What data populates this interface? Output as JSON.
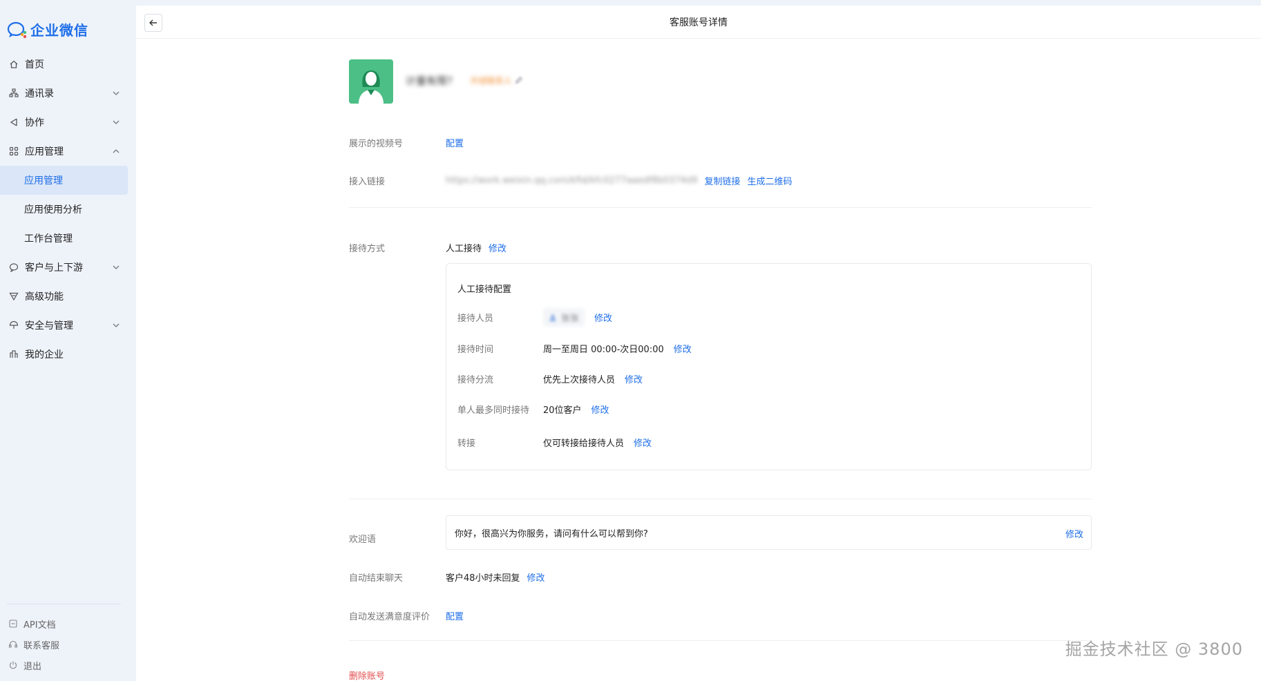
{
  "app": {
    "name": "企业微信",
    "brand_color": "#1e6ee8"
  },
  "sidebar": {
    "items": [
      {
        "label": "首页",
        "icon": "home-icon"
      },
      {
        "label": "通讯录",
        "icon": "org-chart-icon",
        "expandable": true
      },
      {
        "label": "协作",
        "icon": "share-icon",
        "expandable": true
      },
      {
        "label": "应用管理",
        "icon": "grid-icon",
        "expanded": true
      },
      {
        "label": "应用管理",
        "sub": true,
        "active": true
      },
      {
        "label": "应用使用分析",
        "sub": true
      },
      {
        "label": "工作台管理",
        "sub": true
      },
      {
        "label": "客户与上下游",
        "icon": "chat-icon",
        "expandable": true
      },
      {
        "label": "高级功能",
        "icon": "triangle-icon"
      },
      {
        "label": "安全与管理",
        "icon": "umbrella-icon",
        "expandable": true
      },
      {
        "label": "我的企业",
        "icon": "building-icon"
      }
    ],
    "bottom": [
      {
        "label": "API文档",
        "icon": "doc-icon"
      },
      {
        "label": "联系客服",
        "icon": "headset-icon"
      },
      {
        "label": "退出",
        "icon": "power-icon"
      }
    ]
  },
  "header": {
    "title": "客服账号详情"
  },
  "account": {
    "name": "计量有限?",
    "tag": "外部联系人"
  },
  "fields": {
    "video_label": "展示的视频号",
    "video_action": "配置",
    "link_label": "接入链接",
    "link_url": "https://work.weixin.qq.com/kfid/kfc0277aaedf8b0374d9",
    "copy_link": "复制链接",
    "gen_qr": "生成二维码",
    "reception_label": "接待方式",
    "reception_value": "人工接待",
    "reception_edit": "修改"
  },
  "config": {
    "title": "人工接待配置",
    "rows": [
      {
        "label": "接待人员",
        "value": "张张",
        "edit": "修改"
      },
      {
        "label": "接待时间",
        "value": "周一至周日 00:00-次日00:00",
        "edit": "修改"
      },
      {
        "label": "接待分流",
        "value": "优先上次接待人员",
        "edit": "修改"
      },
      {
        "label": "单人最多同时接待",
        "value": "20位客户",
        "edit": "修改"
      },
      {
        "label": "转接",
        "value": "仅可转接给接待人员",
        "edit": "修改"
      }
    ]
  },
  "welcome": {
    "label": "欢迎语",
    "text": "你好，很高兴为你服务，请问有什么可以帮到你?",
    "edit": "修改"
  },
  "auto_end": {
    "label": "自动结束聊天",
    "value": "客户48小时未回复",
    "edit": "修改"
  },
  "satisfaction": {
    "label": "自动发送满意度评价",
    "action": "配置"
  },
  "delete_label": "删除账号",
  "watermark": "掘金技术社区 @ 3800"
}
